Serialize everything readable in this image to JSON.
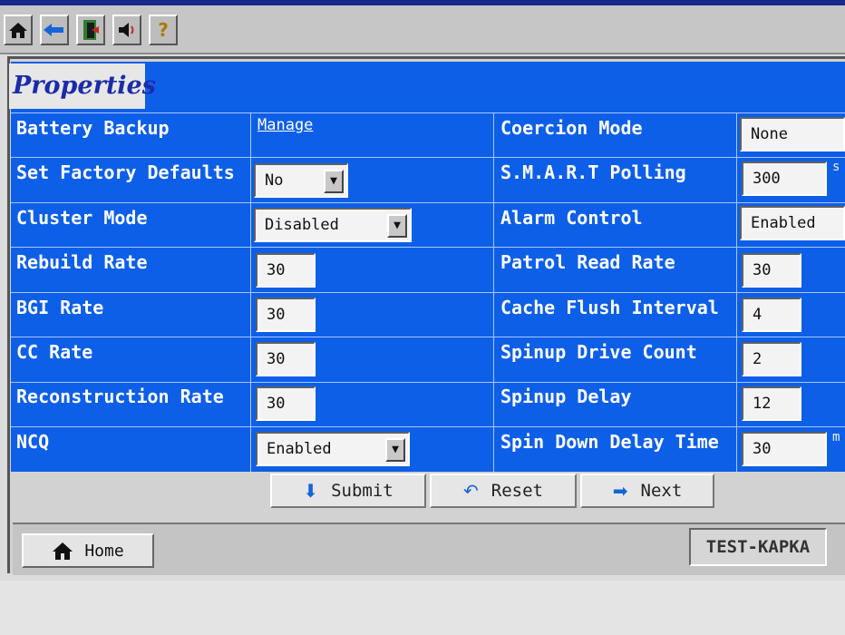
{
  "title": "Properties",
  "left_rows": [
    {
      "label": "Battery Backup",
      "link": "Manage"
    },
    {
      "label": "Set Factory Defaults",
      "select": "No"
    },
    {
      "label": "Cluster Mode",
      "select": "Disabled"
    },
    {
      "label": "Rebuild Rate",
      "value": "30"
    },
    {
      "label": "BGI Rate",
      "value": "30"
    },
    {
      "label": "CC Rate",
      "value": "30"
    },
    {
      "label": "Reconstruction Rate",
      "value": "30"
    },
    {
      "label": "NCQ",
      "select": "Enabled"
    }
  ],
  "right_rows": [
    {
      "label": "Coercion Mode",
      "select": "None"
    },
    {
      "label": "S.M.A.R.T Polling",
      "value": "300",
      "unit": "s"
    },
    {
      "label": "Alarm Control",
      "select": "Enabled"
    },
    {
      "label": "Patrol Read Rate",
      "value": "30"
    },
    {
      "label": "Cache Flush Interval",
      "value": "4"
    },
    {
      "label": "Spinup Drive Count",
      "value": "2"
    },
    {
      "label": "Spinup Delay",
      "value": "12"
    },
    {
      "label": "Spin Down Delay Time",
      "value": "30",
      "unit": "m"
    }
  ],
  "buttons": {
    "submit": "Submit",
    "reset": "Reset",
    "next": "Next"
  },
  "footer": {
    "home": "Home",
    "host": "TEST-KAPKA"
  },
  "icons": {
    "toolbar": [
      "home-icon",
      "back-arrow-icon",
      "exit-door-icon",
      "speaker-icon",
      "help-icon"
    ],
    "submit": "down-arrow-icon",
    "reset": "undo-icon",
    "next": "forward-arrow-icon",
    "home": "home-icon"
  },
  "colors": {
    "panel": "#0d5fe8",
    "title_text": "#1b2ca8",
    "background": "#dcdcdc"
  }
}
